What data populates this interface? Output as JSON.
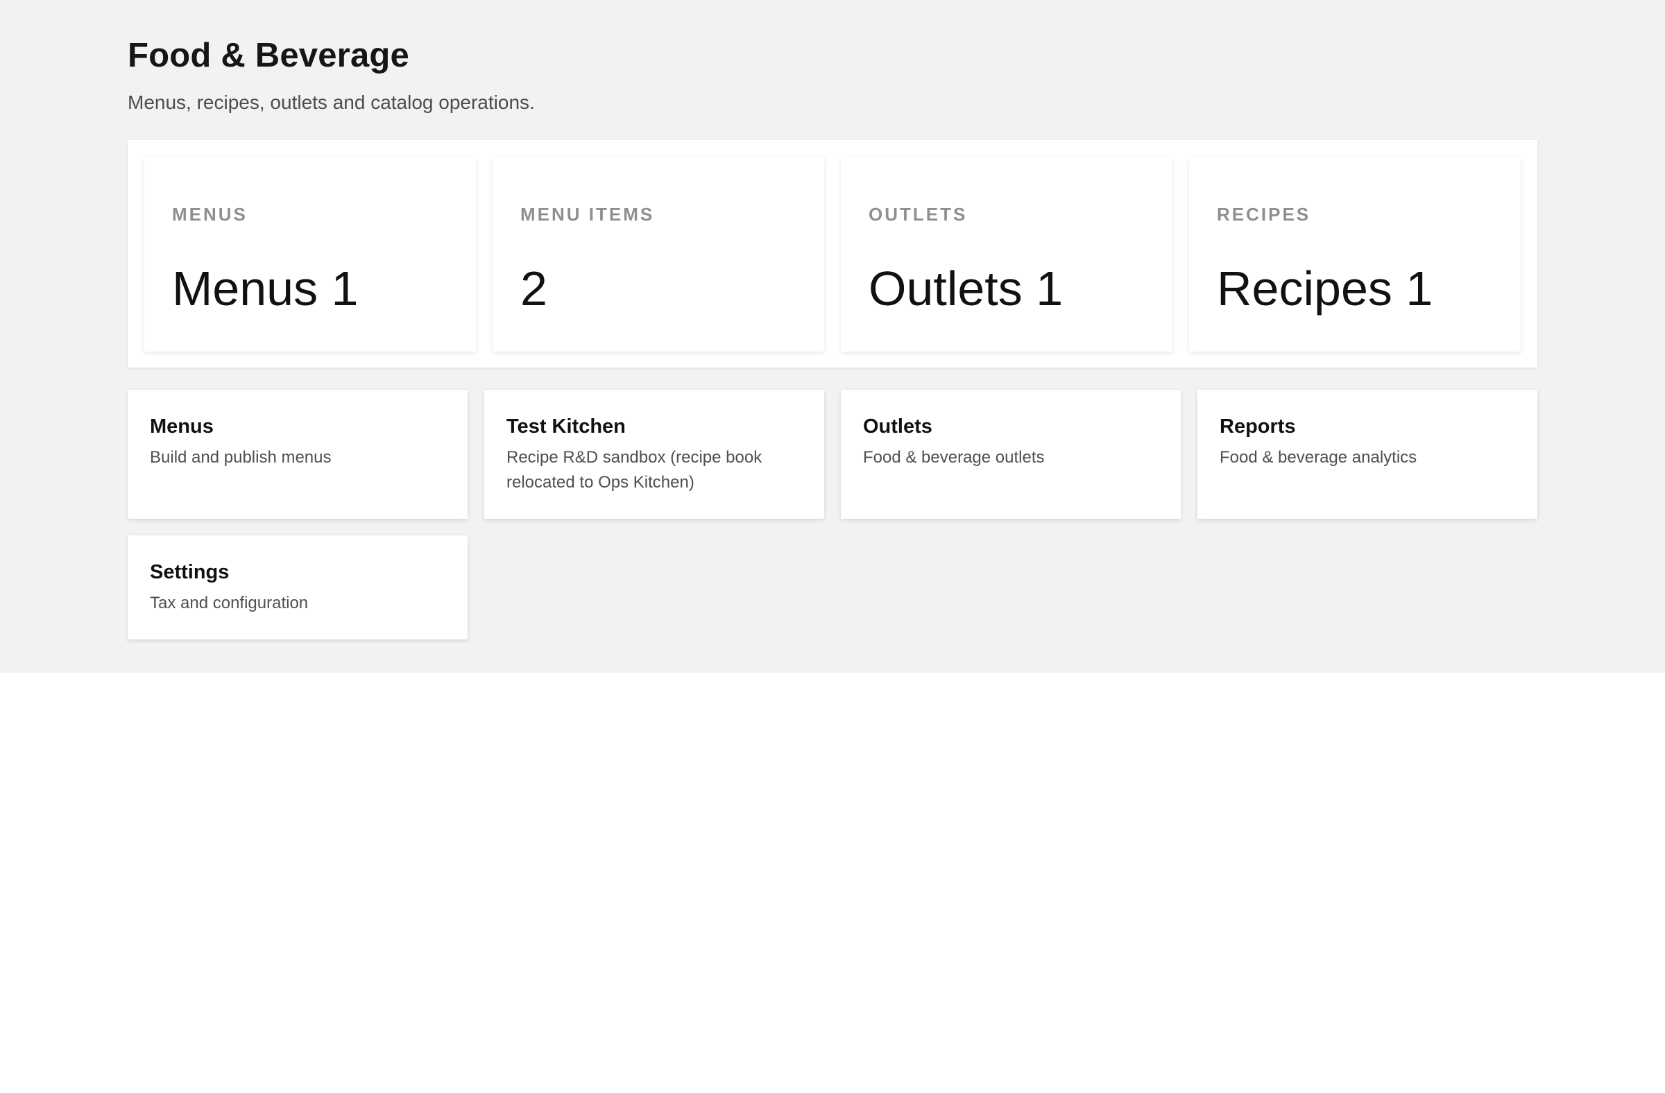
{
  "header": {
    "title": "Food & Beverage",
    "subtitle": "Menus, recipes, outlets and catalog operations."
  },
  "stats": [
    {
      "label": "MENUS",
      "value": "Menus 1"
    },
    {
      "label": "MENU ITEMS",
      "value": "2"
    },
    {
      "label": "OUTLETS",
      "value": "Outlets 1"
    },
    {
      "label": "RECIPES",
      "value": "Recipes 1"
    }
  ],
  "nav_cards": [
    {
      "title": "Menus",
      "description": "Build and publish menus"
    },
    {
      "title": "Test Kitchen",
      "description": "Recipe R&D sandbox (recipe book relocated to Ops Kitchen)"
    },
    {
      "title": "Outlets",
      "description": "Food & beverage outlets"
    },
    {
      "title": "Reports",
      "description": "Food & beverage analytics"
    },
    {
      "title": "Settings",
      "description": "Tax and configuration"
    }
  ]
}
